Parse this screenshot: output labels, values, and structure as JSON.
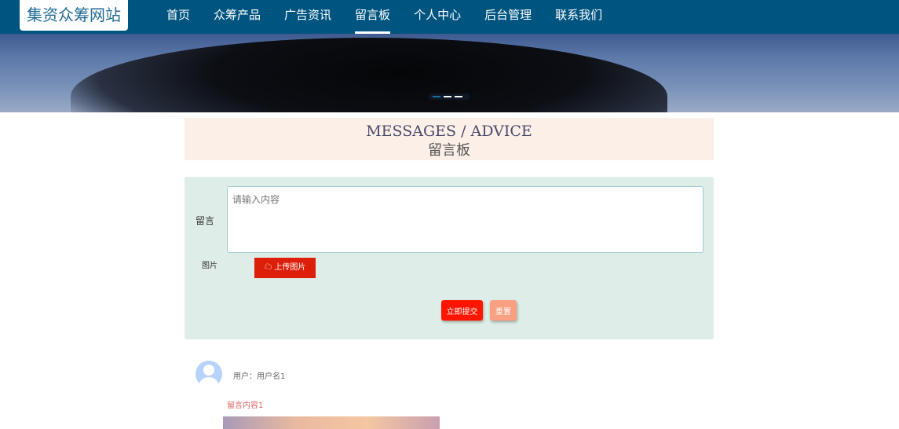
{
  "site": {
    "logo": "集资众筹网站"
  },
  "nav": {
    "items": [
      "首页",
      "众筹产品",
      "广告资讯",
      "留言板",
      "个人中心",
      "后台管理",
      "联系我们"
    ],
    "active": "留言板"
  },
  "header": {
    "title_en": "MESSAGES / ADVICE",
    "title_cn": "留言板"
  },
  "form": {
    "message_label": "留言",
    "placeholder": "请输入内容",
    "image_label": "图片",
    "upload_label": "上传图片",
    "submit_label": "立即提交",
    "reset_label": "重置"
  },
  "messages": [
    {
      "user": "用户：用户名1",
      "content": "留言内容1"
    }
  ]
}
